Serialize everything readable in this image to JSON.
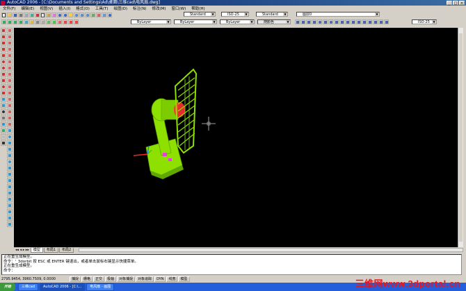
{
  "window": {
    "title": "AutoCAD 2006 - [C:\\Documents and Settings\\Ad\\桌面\\三维cad\\电风扇.dwg]",
    "min": "_",
    "max": "□",
    "close": "×"
  },
  "menu": [
    "文件(F)",
    "编辑(E)",
    "视图(V)",
    "插入(I)",
    "格式(O)",
    "工具(T)",
    "绘图(D)",
    "标注(N)",
    "修改(M)",
    "窗口(W)",
    "帮助(H)"
  ],
  "styles": {
    "text_style": "Standard",
    "dim_style": "ISO-25",
    "table_style": "Standard",
    "layer": "图层0",
    "dim_style_2": "ISO-25"
  },
  "properties": {
    "color": "ByLayer",
    "linetype": "ByLayer",
    "lineweight": "ByLayer",
    "plotstyle": "随颜色"
  },
  "layout_tabs": [
    "模型",
    "布局1",
    "布局2"
  ],
  "command_lines": [
    "正在重生成模型。",
    "命令：'_3dorbit 按 ESC 或 ENTER 键退出，或者单击鼠标右键显示快捷菜单。",
    "正在重生成模型。",
    "",
    "命令："
  ],
  "status": {
    "coords": "2795.9454, 3960.7509, 0.0000",
    "buttons": [
      "捕捉",
      "栅格",
      "正交",
      "极轴",
      "对象捕捉",
      "对象追踪",
      "DYN",
      "线宽",
      "模型"
    ]
  },
  "taskbar": {
    "start": "开始",
    "tasks": [
      "三维cad",
      "AutoCAD 2006 - [C:\\...",
      "电风扇 - 画图"
    ],
    "active_index": 1
  },
  "watermark": "三维网www.3dportal.cn",
  "colors": {
    "canvas": "#000000",
    "model_green": "#8ee000",
    "model_dark": "#5fa800",
    "accent_red": "#ff3030"
  }
}
